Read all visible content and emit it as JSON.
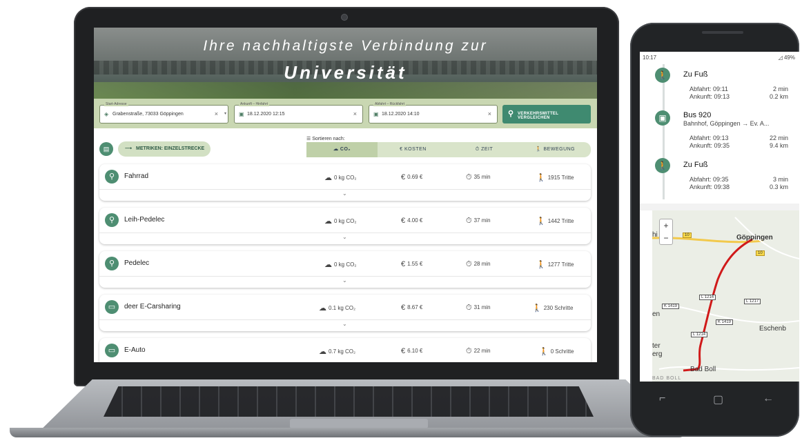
{
  "hero": {
    "line1": "Ihre nachhaltigste Verbindung zur",
    "line2": "Universität"
  },
  "search": {
    "start": {
      "label": "Start-Adresse",
      "value": "Grabenstraße, 73033 Göppingen"
    },
    "arrival": {
      "label": "Ankunft – Hinfahrt",
      "value": "18.12.2020 12:15"
    },
    "departure": {
      "label": "Abfahrt – Rückfahrt",
      "value": "18.12.2020 14:10"
    },
    "compare_button": "VERKEHRSMITTEL VERGLEICHEN"
  },
  "toolbar": {
    "metric_button": "METRIKEN: EINZELSTRECKE",
    "sort_label": "Sortieren nach:"
  },
  "sort_tabs": [
    {
      "label": "CO₂",
      "icon": "cloud-icon"
    },
    {
      "label": "KOSTEN",
      "icon": "euro-icon"
    },
    {
      "label": "ZEIT",
      "icon": "timer-icon"
    },
    {
      "label": "BEWEGUNG",
      "icon": "walk-icon"
    }
  ],
  "results": [
    {
      "name": "Fahrrad",
      "co2": "0 kg CO₂",
      "cost": "0.69 €",
      "time": "35 min",
      "movement": "1915 Tritte",
      "icon": "bike-icon"
    },
    {
      "name": "Leih-Pedelec",
      "co2": "0 kg CO₂",
      "cost": "4.00 €",
      "time": "37 min",
      "movement": "1442 Tritte",
      "icon": "ebike-icon"
    },
    {
      "name": "Pedelec",
      "co2": "0 kg CO₂",
      "cost": "1.55 €",
      "time": "28 min",
      "movement": "1277 Tritte",
      "icon": "ebike-icon"
    },
    {
      "name": "deer E-Carsharing",
      "co2": "0.1 kg CO₂",
      "cost": "8.67 €",
      "time": "31 min",
      "movement": "230 Schritte",
      "icon": "car-icon"
    },
    {
      "name": "E-Auto",
      "co2": "0.7 kg CO₂",
      "cost": "6.10 €",
      "time": "22 min",
      "movement": "0 Schritte",
      "icon": "car-icon"
    }
  ],
  "phone": {
    "status_time": "10:17",
    "status_right": "49%",
    "steps": [
      {
        "title": "Zu Fuß",
        "dep": "Abfahrt: 09:11",
        "arr": "Ankunft: 09:13",
        "dur": "2 min",
        "dist": "0.2 km"
      },
      {
        "title": "Bus 920",
        "sub": "Bahnhof, Göppingen → Ev. A...",
        "dep": "Abfahrt: 09:13",
        "arr": "Ankunft: 09:35",
        "dur": "22 min",
        "dist": "9.4 km"
      },
      {
        "title": "Zu Fuß",
        "dep": "Abfahrt: 09:35",
        "arr": "Ankunft: 09:38",
        "dur": "3 min",
        "dist": "0.3 km"
      }
    ],
    "map": {
      "labels": {
        "goeppingen": "Göppingen",
        "eschenb": "Eschenb",
        "bad_boll": "Bad Boll",
        "bad_boll_caps": "BAD BOLL",
        "hi": "hi",
        "en": "en",
        "ter": "ter",
        "erg": "erg"
      },
      "roads": {
        "r10a": "10",
        "r10b": "10",
        "l1214": "L 1214",
        "l1217": "L 1217",
        "k1419a": "K 1419",
        "k1419b": "K 1419",
        "l1214b": "L 1214"
      },
      "zoom_in": "+",
      "zoom_out": "−"
    }
  }
}
